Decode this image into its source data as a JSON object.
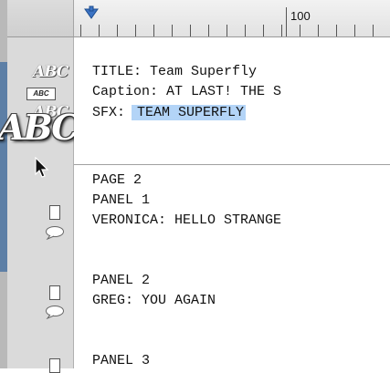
{
  "ruler": {
    "label": "100"
  },
  "gutter": {
    "icons": [
      "abc-title-icon",
      "abc-caption-icon",
      "abc-sfx-icon",
      "abc-drag-icon",
      "panel-icon",
      "balloon-icon"
    ],
    "sample_text": {
      "italic": "ABC",
      "boxed": "ABC",
      "drag": "ABC"
    }
  },
  "editor": {
    "block1": [
      {
        "prefix": "TITLE: ",
        "text": "Team Superfly"
      },
      {
        "prefix": "Caption: ",
        "text": "AT LAST! THE S"
      },
      {
        "prefix": "SFX: ",
        "text": "TEAM SUPERFLY",
        "selected": true
      }
    ],
    "block2": {
      "page": "PAGE 2",
      "panel1": "PANEL 1",
      "dialogue1": "VERONICA: HELLO STRANGE",
      "panel2": "PANEL 2",
      "dialogue2": "GREG: YOU AGAIN",
      "panel3": "PANEL 3"
    }
  },
  "colors": {
    "selection": "#b3d4f7",
    "gutter": "#dadada",
    "rail": "#5d7fa6"
  }
}
